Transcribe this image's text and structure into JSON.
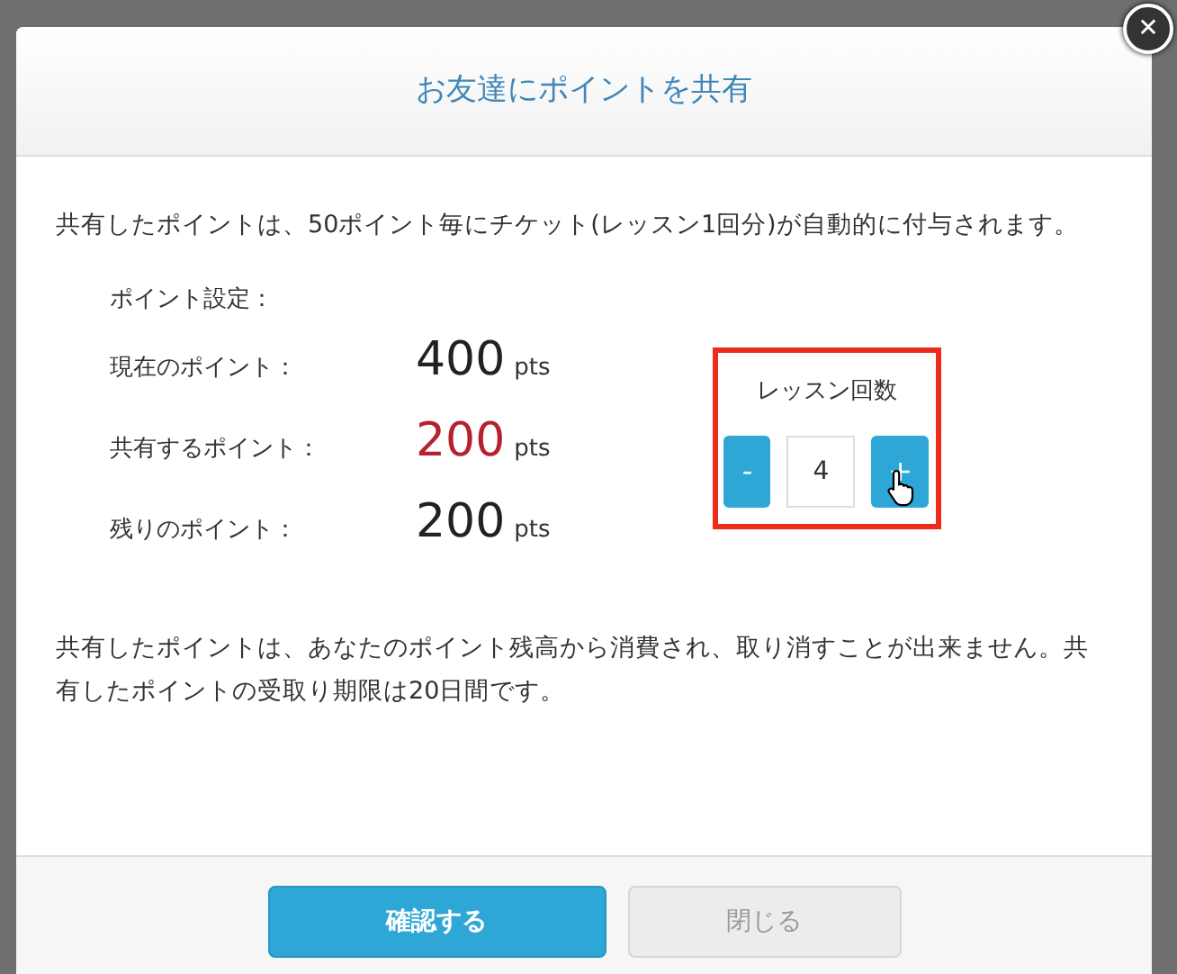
{
  "dialog": {
    "title": "お友達にポイントを共有",
    "close": "✕"
  },
  "intro": "共有したポイントは、50ポイント毎にチケット(レッスン1回分)が自動的に付与されます。",
  "settings": {
    "heading": "ポイント設定：",
    "rows": [
      {
        "label": "現在のポイント：",
        "amount": "400",
        "unit": "pts",
        "color": "#222222"
      },
      {
        "label": "共有するポイント：",
        "amount": "200",
        "unit": "pts",
        "color": "#b5222e"
      },
      {
        "label": "残りのポイント：",
        "amount": "200",
        "unit": "pts",
        "color": "#222222"
      }
    ]
  },
  "lesson_counter": {
    "label": "レッスン回数",
    "minus": "-",
    "value": "4",
    "plus": "+",
    "highlighted": true
  },
  "notice": "共有したポイントは、あなたのポイント残高から消費され、取り消すことが出来ません。共有したポイントの受取り期限は20日間です。",
  "buttons": [
    {
      "label": "確認する",
      "kind": "primary"
    },
    {
      "label": "閉じる",
      "kind": "secondary"
    }
  ]
}
